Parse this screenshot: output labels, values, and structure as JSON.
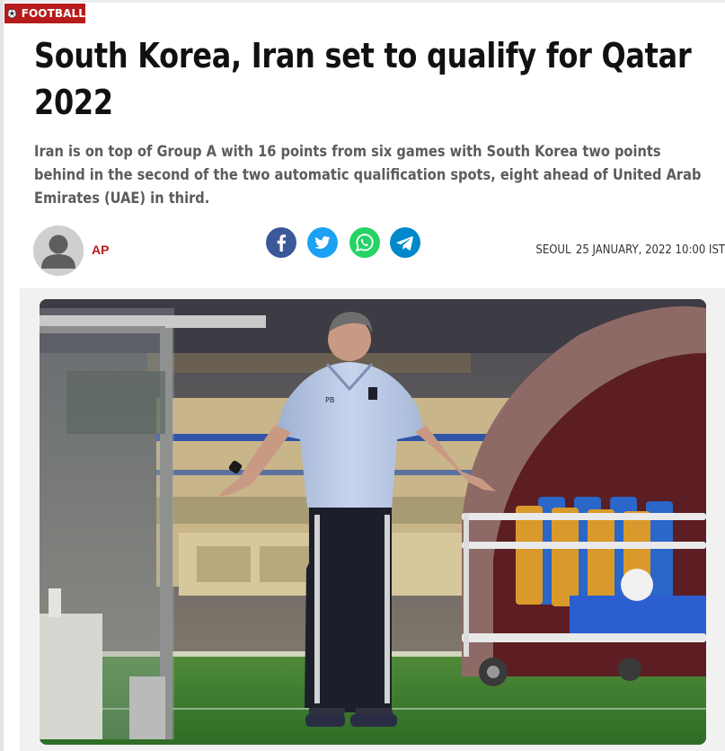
{
  "article": {
    "category": "FOOTBALL",
    "headline": "South Korea, Iran set to qualify for Qatar 2022",
    "summary": "Iran is on top of Group A with 16 points from six games with South Korea two points behind in the second of the two automatic qualification spots, eight ahead of United Arab Emirates (UAE) in third.",
    "author": "AP",
    "location": "SEOUL",
    "datetime": "25 JANUARY, 2022 10:00 IST"
  },
  "share": {
    "icons": [
      "facebook-icon",
      "twitter-icon",
      "whatsapp-icon",
      "telegram-icon"
    ],
    "colors": {
      "facebook": "#3b5998",
      "twitter": "#1da1f2",
      "whatsapp": "#25d366",
      "telegram": "#0088cc"
    }
  },
  "photo": {
    "subject": "coach-on-touchline",
    "shirt_initials": "PB"
  },
  "colors": {
    "accent": "#b71c1c",
    "headline": "#111111",
    "summary": "#5c5c5c"
  }
}
